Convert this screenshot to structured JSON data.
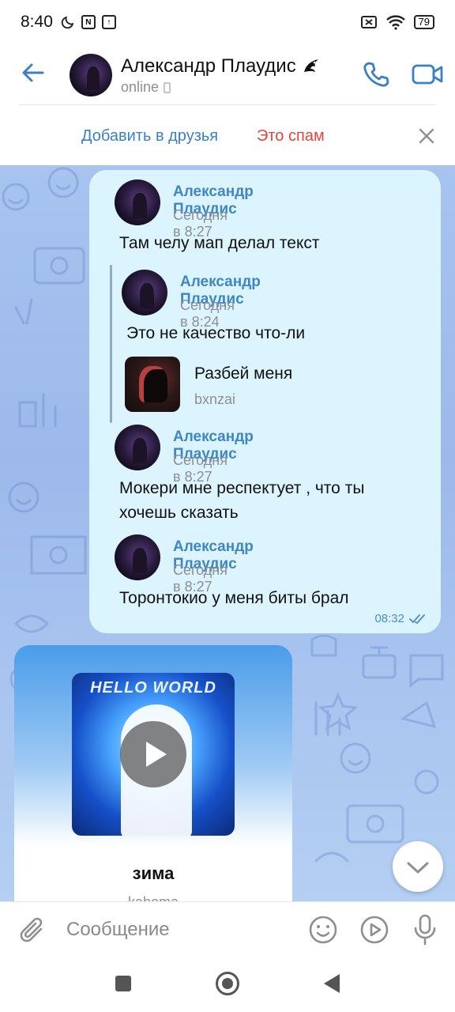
{
  "status_bar": {
    "time": "8:40",
    "battery": "79"
  },
  "header": {
    "contact_name": "Александр Плаудис",
    "status": "online"
  },
  "friend_bar": {
    "add_friend": "Добавить в друзья",
    "spam": "Это спам"
  },
  "message": {
    "quotes": [
      {
        "author": "Александр Плаудис",
        "time": "Сегодня в 8:27",
        "text": "Там челу мап делал текст"
      },
      {
        "author": "Александр Плаудис",
        "time": "Сегодня в 8:24",
        "text": "Это не качество что-ли",
        "attachment": {
          "title": "Разбей меня",
          "artist": "bxnzai"
        }
      },
      {
        "author": "Александр Плаудис",
        "time": "Сегодня в 8:27",
        "text_line1": "Мокери мне респектует , что ты",
        "text_line2": "хочешь сказать"
      },
      {
        "author": "Александр Плаудис",
        "time": "Сегодня в 8:27",
        "text": "Торонтокио у меня биты брал"
      }
    ],
    "sent_time": "08:32"
  },
  "music_card": {
    "cover_text": "HELLO WORLD",
    "title": "зима",
    "artist": "kahoma"
  },
  "input": {
    "placeholder": "Сообщение"
  },
  "icons": {
    "back": "arrow-left-icon",
    "call": "phone-icon",
    "video": "video-camera-icon",
    "close": "close-icon",
    "attach": "paperclip-icon",
    "emoji": "smile-icon",
    "sticker": "play-circle-icon",
    "mic": "microphone-icon",
    "read": "double-check-icon",
    "scroll_down": "chevron-down-icon"
  },
  "colors": {
    "accent": "#3a80c8",
    "spam": "#e0443c",
    "bubble": "#dcf4fd"
  }
}
